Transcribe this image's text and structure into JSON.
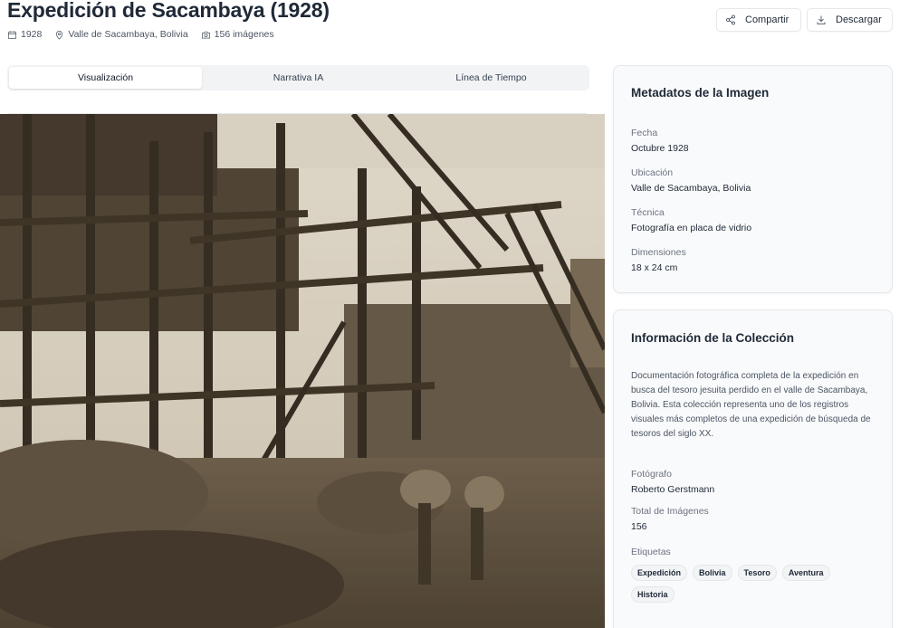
{
  "header": {
    "title": "Expedición de Sacambaya (1928)",
    "year": "1928",
    "location": "Valle de Sacambaya, Bolivia",
    "image_count": "156 imágenes"
  },
  "actions": {
    "share_label": "Compartir",
    "download_label": "Descargar"
  },
  "tabs": [
    {
      "label": "Visualización",
      "active": true
    },
    {
      "label": "Narrativa IA",
      "active": false
    },
    {
      "label": "Línea de Tiempo",
      "active": false
    }
  ],
  "metadata_card": {
    "title": "Metadatos de la Imagen",
    "fields": [
      {
        "label": "Fecha",
        "value": "Octubre 1928"
      },
      {
        "label": "Ubicación",
        "value": "Valle de Sacambaya, Bolivia"
      },
      {
        "label": "Técnica",
        "value": "Fotografía en placa de vidrio"
      },
      {
        "label": "Dimensiones",
        "value": "18 x 24 cm"
      }
    ]
  },
  "collection_card": {
    "title": "Información de la Colección",
    "description": "Documentación fotográfica completa de la expedición en busca del tesoro jesuita perdido en el valle de Sacambaya, Bolivia. Esta colección representa uno de los registros visuales más completos de una expedición de búsqueda de tesoros del siglo XX.",
    "photographer_label": "Fotógrafo",
    "photographer": "Roberto Gerstmann",
    "total_label": "Total de Imágenes",
    "total": "156",
    "tags_label": "Etiquetas",
    "tags": [
      "Expedición",
      "Bolivia",
      "Tesoro",
      "Aventura",
      "Historia"
    ]
  },
  "icons": [
    "calendar-icon",
    "map-pin-icon",
    "camera-icon",
    "share-icon",
    "download-icon"
  ]
}
